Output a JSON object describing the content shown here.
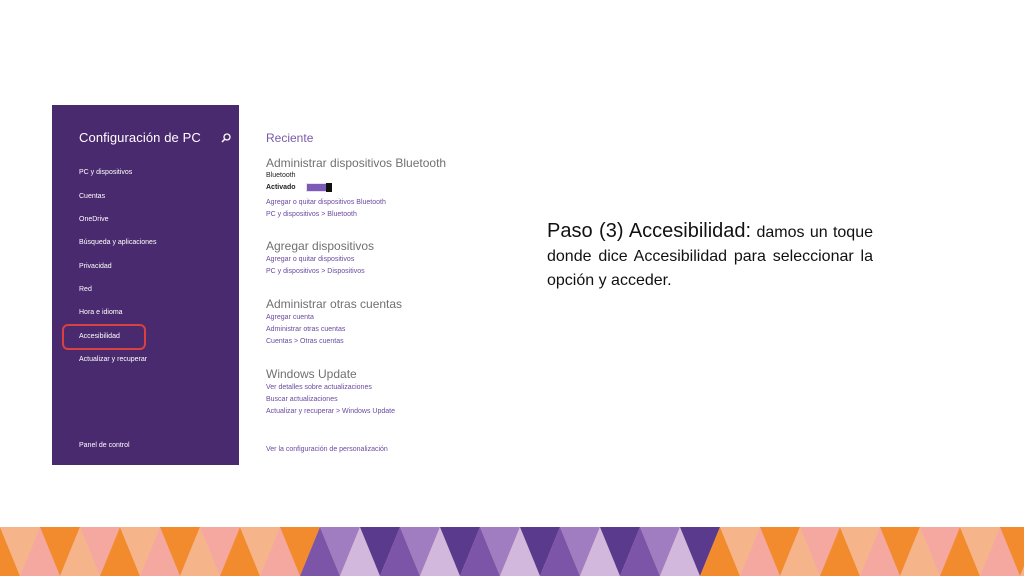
{
  "window": {
    "sidebar": {
      "title": "Configuración de PC",
      "items": [
        {
          "label": "PC y dispositivos"
        },
        {
          "label": "Cuentas"
        },
        {
          "label": "OneDrive"
        },
        {
          "label": "Búsqueda y aplicaciones"
        },
        {
          "label": "Privacidad"
        },
        {
          "label": "Red"
        },
        {
          "label": "Hora e idioma"
        },
        {
          "label": "Accesibilidad"
        },
        {
          "label": "Actualizar y recuperar"
        }
      ],
      "footer": "Panel de control",
      "highlighted_item": "Accesibilidad"
    },
    "content": {
      "recent_heading": "Reciente",
      "bluetooth": {
        "heading": "Administrar dispositivos Bluetooth",
        "label": "Bluetooth",
        "state_label": "Activado",
        "links": [
          "Agregar o quitar dispositivos Bluetooth",
          "PC y dispositivos > Bluetooth"
        ]
      },
      "add_devices": {
        "heading": "Agregar dispositivos",
        "links": [
          "Agregar o quitar dispositivos",
          "PC y dispositivos > Dispositivos"
        ]
      },
      "other_accounts": {
        "heading": "Administrar otras cuentas",
        "links": [
          "Agregar cuenta",
          "Administrar otras cuentas",
          "Cuentas > Otras cuentas"
        ]
      },
      "windows_update": {
        "heading": "Windows Update",
        "links": [
          "Ver detalles sobre actualizaciones",
          "Buscar actualizaciones",
          "Actualizar y recuperar > Windows Update"
        ]
      },
      "bottom_link": "Ver la configuración de personalización"
    }
  },
  "instruction": {
    "bold": "Paso (3) Accesibilidad:",
    "rest": " damos un toque donde dice Accesibilidad para seleccionar la opción y acceder."
  },
  "colors": {
    "sidebar": "#4a2a6e",
    "link": "#6a4aa0",
    "toggle": "#7d5ab8",
    "highlight": "#d94040",
    "banner": [
      "#f28a2e",
      "#f5b48a",
      "#f5a8a0",
      "#7c55a8",
      "#a07cc0",
      "#d2b8dc",
      "#5a3a8c"
    ]
  }
}
